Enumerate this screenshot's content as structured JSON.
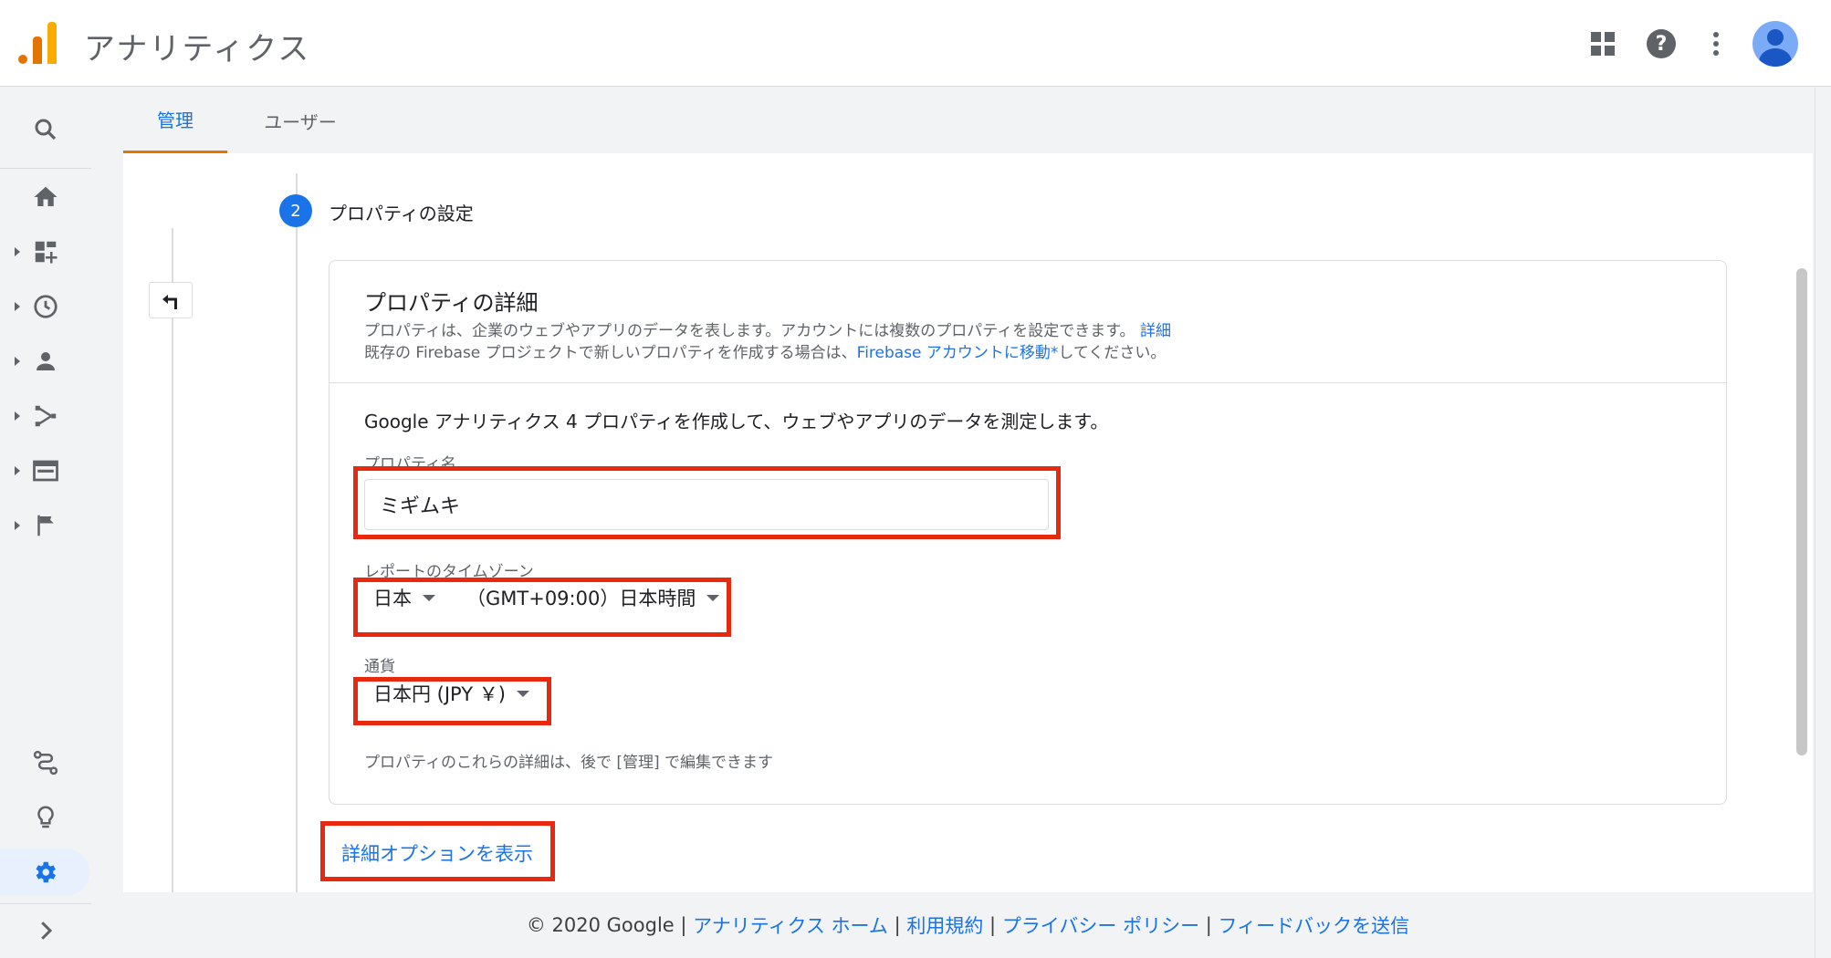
{
  "header": {
    "app_title": "アナリティクス"
  },
  "tabs": [
    {
      "label": "管理",
      "active": true
    },
    {
      "label": "ユーザー",
      "active": false
    }
  ],
  "step": {
    "number": "2",
    "title": "プロパティの設定"
  },
  "card": {
    "title": "プロパティの詳細",
    "desc_line1": "プロパティは、企業のウェブやアプリのデータを表します。アカウントには複数のプロパティを設定できます。",
    "desc_link1": "詳細",
    "desc_line2_pre": "既存の Firebase プロジェクトで新しいプロパティを作成する場合は、",
    "desc_link2": "Firebase アカウントに移動*",
    "desc_line2_post": "してください。",
    "intro": "Google アナリティクス 4 プロパティを作成して、ウェブやアプリのデータを測定します。",
    "property_name_label": "プロパティ名",
    "property_name_value": "ミギムキ",
    "timezone_label": "レポートのタイムゾーン",
    "timezone_country": "日本",
    "timezone_zone": "（GMT+09:00）日本時間",
    "currency_label": "通貨",
    "currency_value": "日本円 (JPY ￥)",
    "hint": "プロパティのこれらの詳細は、後で [管理] で編集できます"
  },
  "advanced_link": "詳細オプションを表示",
  "footer": {
    "copyright": "© 2020 Google",
    "sep": "|",
    "link_home": "アナリティクス ホーム",
    "link_terms": "利用規約",
    "link_privacy": "プライバシー ポリシー",
    "link_feedback": "フィードバックを送信"
  },
  "colors": {
    "accent": "#1a73e8",
    "tab_indicator": "#e37400",
    "highlight_box": "#e8280f"
  }
}
